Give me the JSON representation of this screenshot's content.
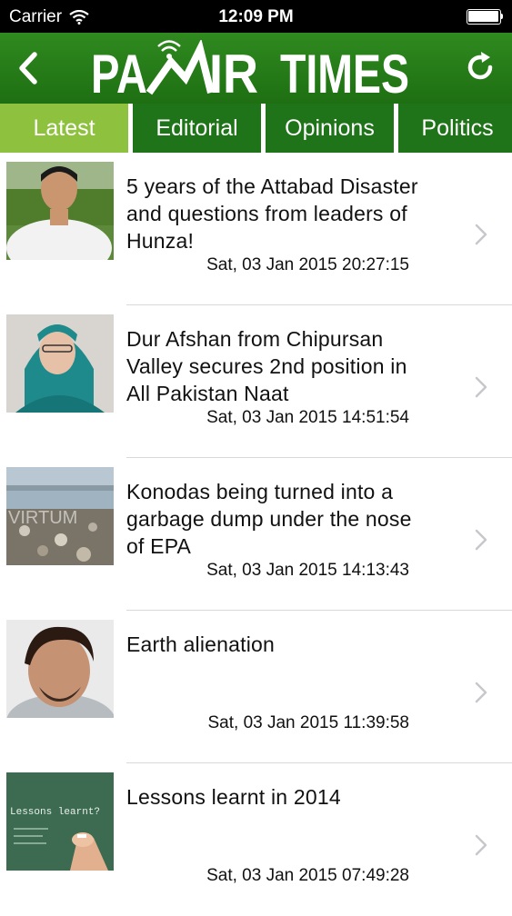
{
  "status_bar": {
    "carrier": "Carrier",
    "time": "12:09 PM"
  },
  "header": {
    "logo_text": "PAMIR TIMES",
    "back_icon": "chevron-left-icon",
    "refresh_icon": "refresh-icon",
    "brand_color": "#1f7318"
  },
  "tabs": [
    {
      "label": "Latest",
      "active": true
    },
    {
      "label": "Editorial",
      "active": false
    },
    {
      "label": "Opinions",
      "active": false
    },
    {
      "label": "Politics",
      "active": false
    }
  ],
  "articles": [
    {
      "title": "5 years of the Attabad Disaster and questions from leaders of Hunza!",
      "date": "Sat, 03 Jan 2015 20:27:15"
    },
    {
      "title": "Dur Afshan from Chipursan Valley secures 2nd position in All Pakistan Naat",
      "date": "Sat, 03 Jan 2015 14:51:54"
    },
    {
      "title": "Konodas being turned into a garbage dump under the nose of EPA",
      "date": "Sat, 03 Jan 2015 14:13:43"
    },
    {
      "title": "Earth alienation",
      "date": "Sat, 03 Jan 2015 11:39:58"
    },
    {
      "title": "Lessons learnt in 2014",
      "date": "Sat, 03 Jan 2015 07:49:28"
    }
  ],
  "thumbnail_texts": {
    "article_3_watermark": "VIRTUM",
    "article_5_board": "Lessons learnt?"
  }
}
